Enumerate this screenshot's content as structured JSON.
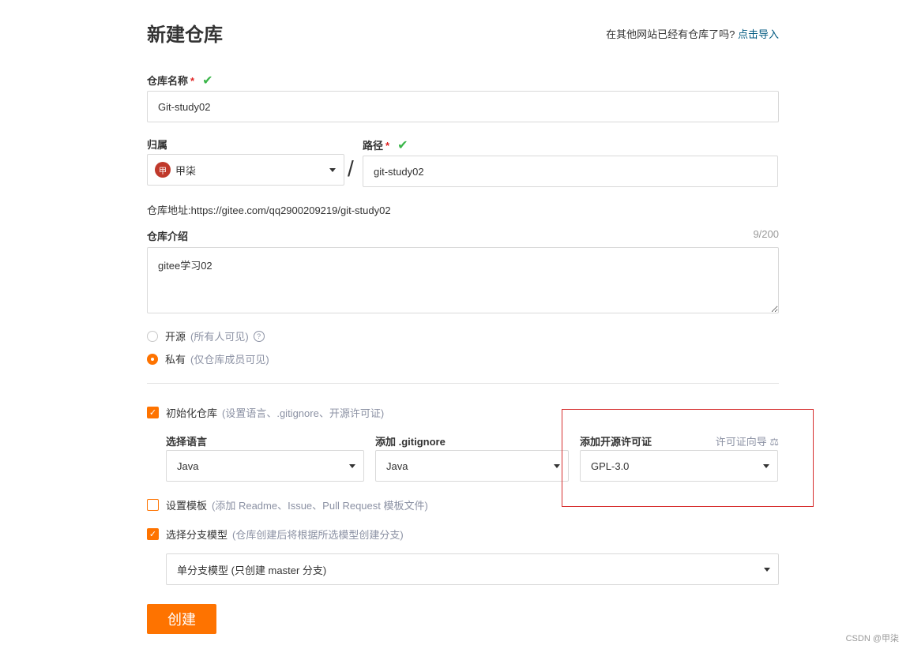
{
  "header": {
    "title": "新建仓库",
    "import_prompt": "在其他网站已经有仓库了吗?",
    "import_link": "点击导入"
  },
  "repo_name": {
    "label": "仓库名称",
    "required": "*",
    "value": "Git-study02"
  },
  "owner": {
    "label": "归属",
    "avatar_text": "甲",
    "value": "甲柒"
  },
  "separator": "/",
  "path": {
    "label": "路径",
    "required": "*",
    "value": "git-study02"
  },
  "repo_address": "仓库地址:https://gitee.com/qq2900209219/git-study02",
  "description": {
    "label": "仓库介绍",
    "counter": "9/200",
    "value": "gitee学习02"
  },
  "visibility": {
    "public_label": "开源",
    "public_hint": "(所有人可见)",
    "private_label": "私有",
    "private_hint": "(仅仓库成员可见)",
    "selected": "private"
  },
  "init_repo": {
    "label": "初始化仓库",
    "hint": "(设置语言、.gitignore、开源许可证)",
    "checked": true
  },
  "language": {
    "label": "选择语言",
    "value": "Java"
  },
  "gitignore": {
    "label": "添加 .gitignore",
    "value": "Java"
  },
  "license": {
    "label": "添加开源许可证",
    "guide": "许可证向导",
    "value": "GPL-3.0"
  },
  "template": {
    "label": "设置模板",
    "hint": "(添加 Readme、Issue、Pull Request 模板文件)",
    "checked": false
  },
  "branch_model": {
    "label": "选择分支模型",
    "hint": "(仓库创建后将根据所选模型创建分支)",
    "checked": true,
    "value": "单分支模型 (只创建 master 分支)"
  },
  "create_button": "创建",
  "watermark": "CSDN @甲柒",
  "colors": {
    "accent": "#fe7300",
    "check": "#3bb64a",
    "link": "#005980",
    "highlight_box": "#d62e2e"
  }
}
